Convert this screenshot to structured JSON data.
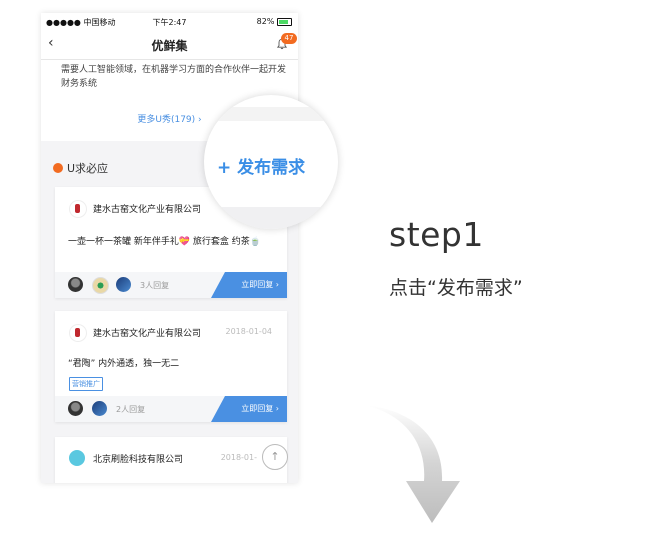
{
  "status_bar": {
    "carrier": "●●●●● 中国移动",
    "time": "下午2:47",
    "battery": "82%"
  },
  "nav": {
    "back": "‹",
    "title": "优鲜集",
    "notifications": "47"
  },
  "top_card": {
    "snippet": "需要人工智能领域，在机器学习方面的合作伙伴一起开发财务系统",
    "more_link": "更多U秀(179) ›"
  },
  "section": {
    "title": "U求必应"
  },
  "cards": [
    {
      "company": "建水古窑文化产业有限公司",
      "date": "",
      "body": "一壶一杯一茶罐 新年伴手礼💝 旅行套盒 约茶🍵",
      "tag": "",
      "reply_count": "3人回复",
      "reply_button": "立即回复 ›"
    },
    {
      "company": "建水古窑文化产业有限公司",
      "date": "2018-01-04",
      "body": "“君陶” 内外通透，独一无二",
      "tag": "营销推广",
      "reply_count": "2人回复",
      "reply_button": "立即回复 ›"
    },
    {
      "company": "北京刷脸科技有限公司",
      "date": "2018-01-",
      "body": "",
      "tag": "",
      "reply_count": "",
      "reply_button": ""
    }
  ],
  "magnifier": {
    "label": "+ 发布需求"
  },
  "tutorial": {
    "step": "step1",
    "instruction": "点击“发布需求”"
  },
  "colors": {
    "accent_blue": "#4a90e2",
    "badge_orange": "#f26b21"
  }
}
